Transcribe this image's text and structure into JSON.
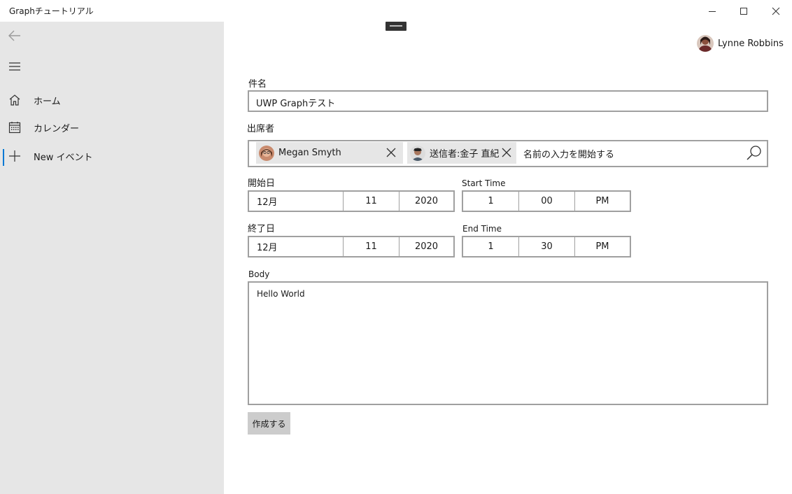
{
  "window": {
    "title": "Graphチュートリアル"
  },
  "nav": {
    "items": [
      {
        "label": "ホーム",
        "icon": "home-icon"
      },
      {
        "label": "カレンダー",
        "icon": "calendar-icon"
      },
      {
        "label": "New イベント",
        "icon": "plus-icon",
        "selected": true
      }
    ]
  },
  "user": {
    "name": "Lynne Robbins"
  },
  "form": {
    "subject": {
      "label": "件名",
      "value": "UWP Graphテスト"
    },
    "attendees": {
      "label": "出席者",
      "tokens": [
        {
          "name": "Megan Smyth"
        },
        {
          "name": "送信者:金子 直紀"
        }
      ],
      "input_text": "名前の入力を開始する"
    },
    "start_date": {
      "label": "開始日",
      "month": "12月",
      "day": "11",
      "year": "2020"
    },
    "start_time": {
      "label": "Start Time",
      "hour": "1",
      "minute": "00",
      "period": "PM"
    },
    "end_date": {
      "label": "終了日",
      "month": "12月",
      "day": "11",
      "year": "2020"
    },
    "end_time": {
      "label": "End Time",
      "hour": "1",
      "minute": "30",
      "period": "PM"
    },
    "body": {
      "label": "Body",
      "value": "Hello World"
    },
    "create_label": "作成する"
  },
  "colors": {
    "sidebar": "#e6e6e6",
    "accent": "#0078d4",
    "border": "#a0a0a0",
    "button": "#cccccc"
  }
}
